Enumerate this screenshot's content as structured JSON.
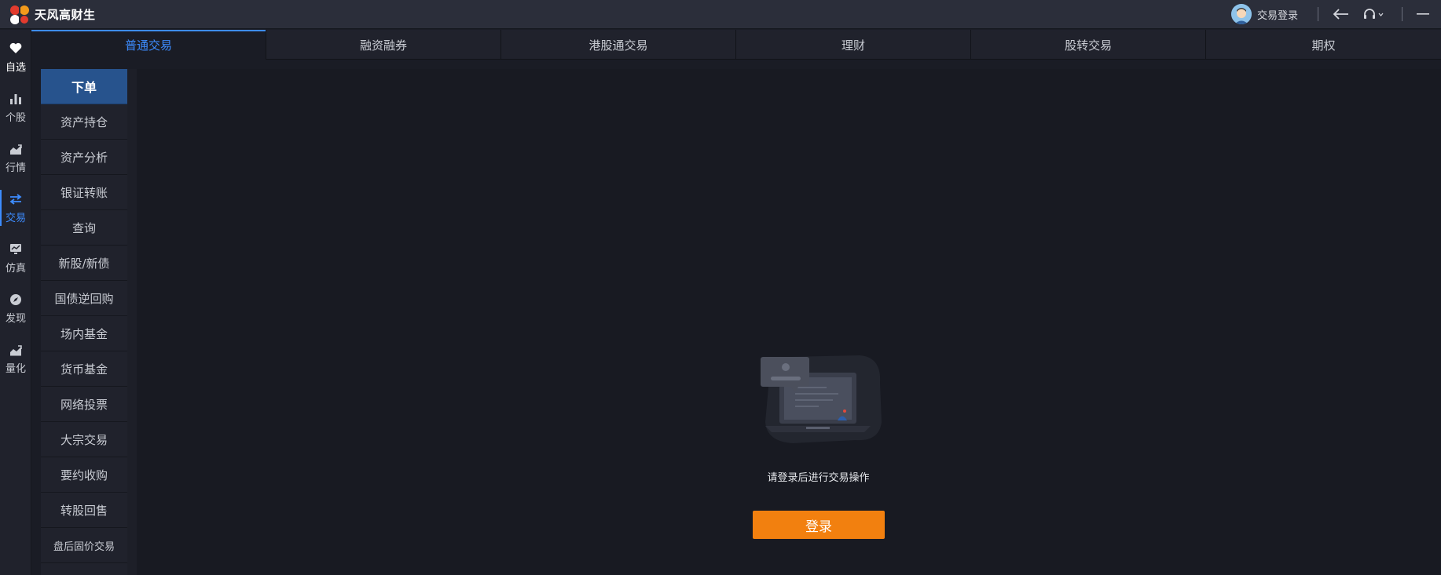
{
  "app": {
    "title": "天风高财生"
  },
  "titlebar": {
    "login_label": "交易登录"
  },
  "rail": {
    "items": [
      {
        "label": "自选",
        "icon": "heart-icon"
      },
      {
        "label": "个股",
        "icon": "bar-chart-icon"
      },
      {
        "label": "行情",
        "icon": "market-trend-icon"
      },
      {
        "label": "交易",
        "icon": "swap-arrows-icon",
        "active": true
      },
      {
        "label": "仿真",
        "icon": "simulation-monitor-icon"
      },
      {
        "label": "发现",
        "icon": "compass-icon"
      },
      {
        "label": "量化",
        "icon": "quant-chart-icon"
      }
    ]
  },
  "tabs": [
    {
      "label": "普通交易",
      "active": true
    },
    {
      "label": "融资融券"
    },
    {
      "label": "港股通交易"
    },
    {
      "label": "理财"
    },
    {
      "label": "股转交易"
    },
    {
      "label": "期权"
    }
  ],
  "submenu": [
    {
      "label": "下单",
      "active": true
    },
    {
      "label": "资产持仓"
    },
    {
      "label": "资产分析"
    },
    {
      "label": "银证转账"
    },
    {
      "label": "查询"
    },
    {
      "label": "新股/新债"
    },
    {
      "label": "国债逆回购"
    },
    {
      "label": "场内基金"
    },
    {
      "label": "货币基金"
    },
    {
      "label": "网络投票"
    },
    {
      "label": "大宗交易"
    },
    {
      "label": "要约收购"
    },
    {
      "label": "转股回售"
    },
    {
      "label": "盘后固价交易"
    }
  ],
  "main": {
    "prompt": "请登录后进行交易操作",
    "login_button": "登录"
  },
  "colors": {
    "accent": "#3d8cff",
    "button": "#f2800f",
    "active_submenu": "#27538d"
  }
}
